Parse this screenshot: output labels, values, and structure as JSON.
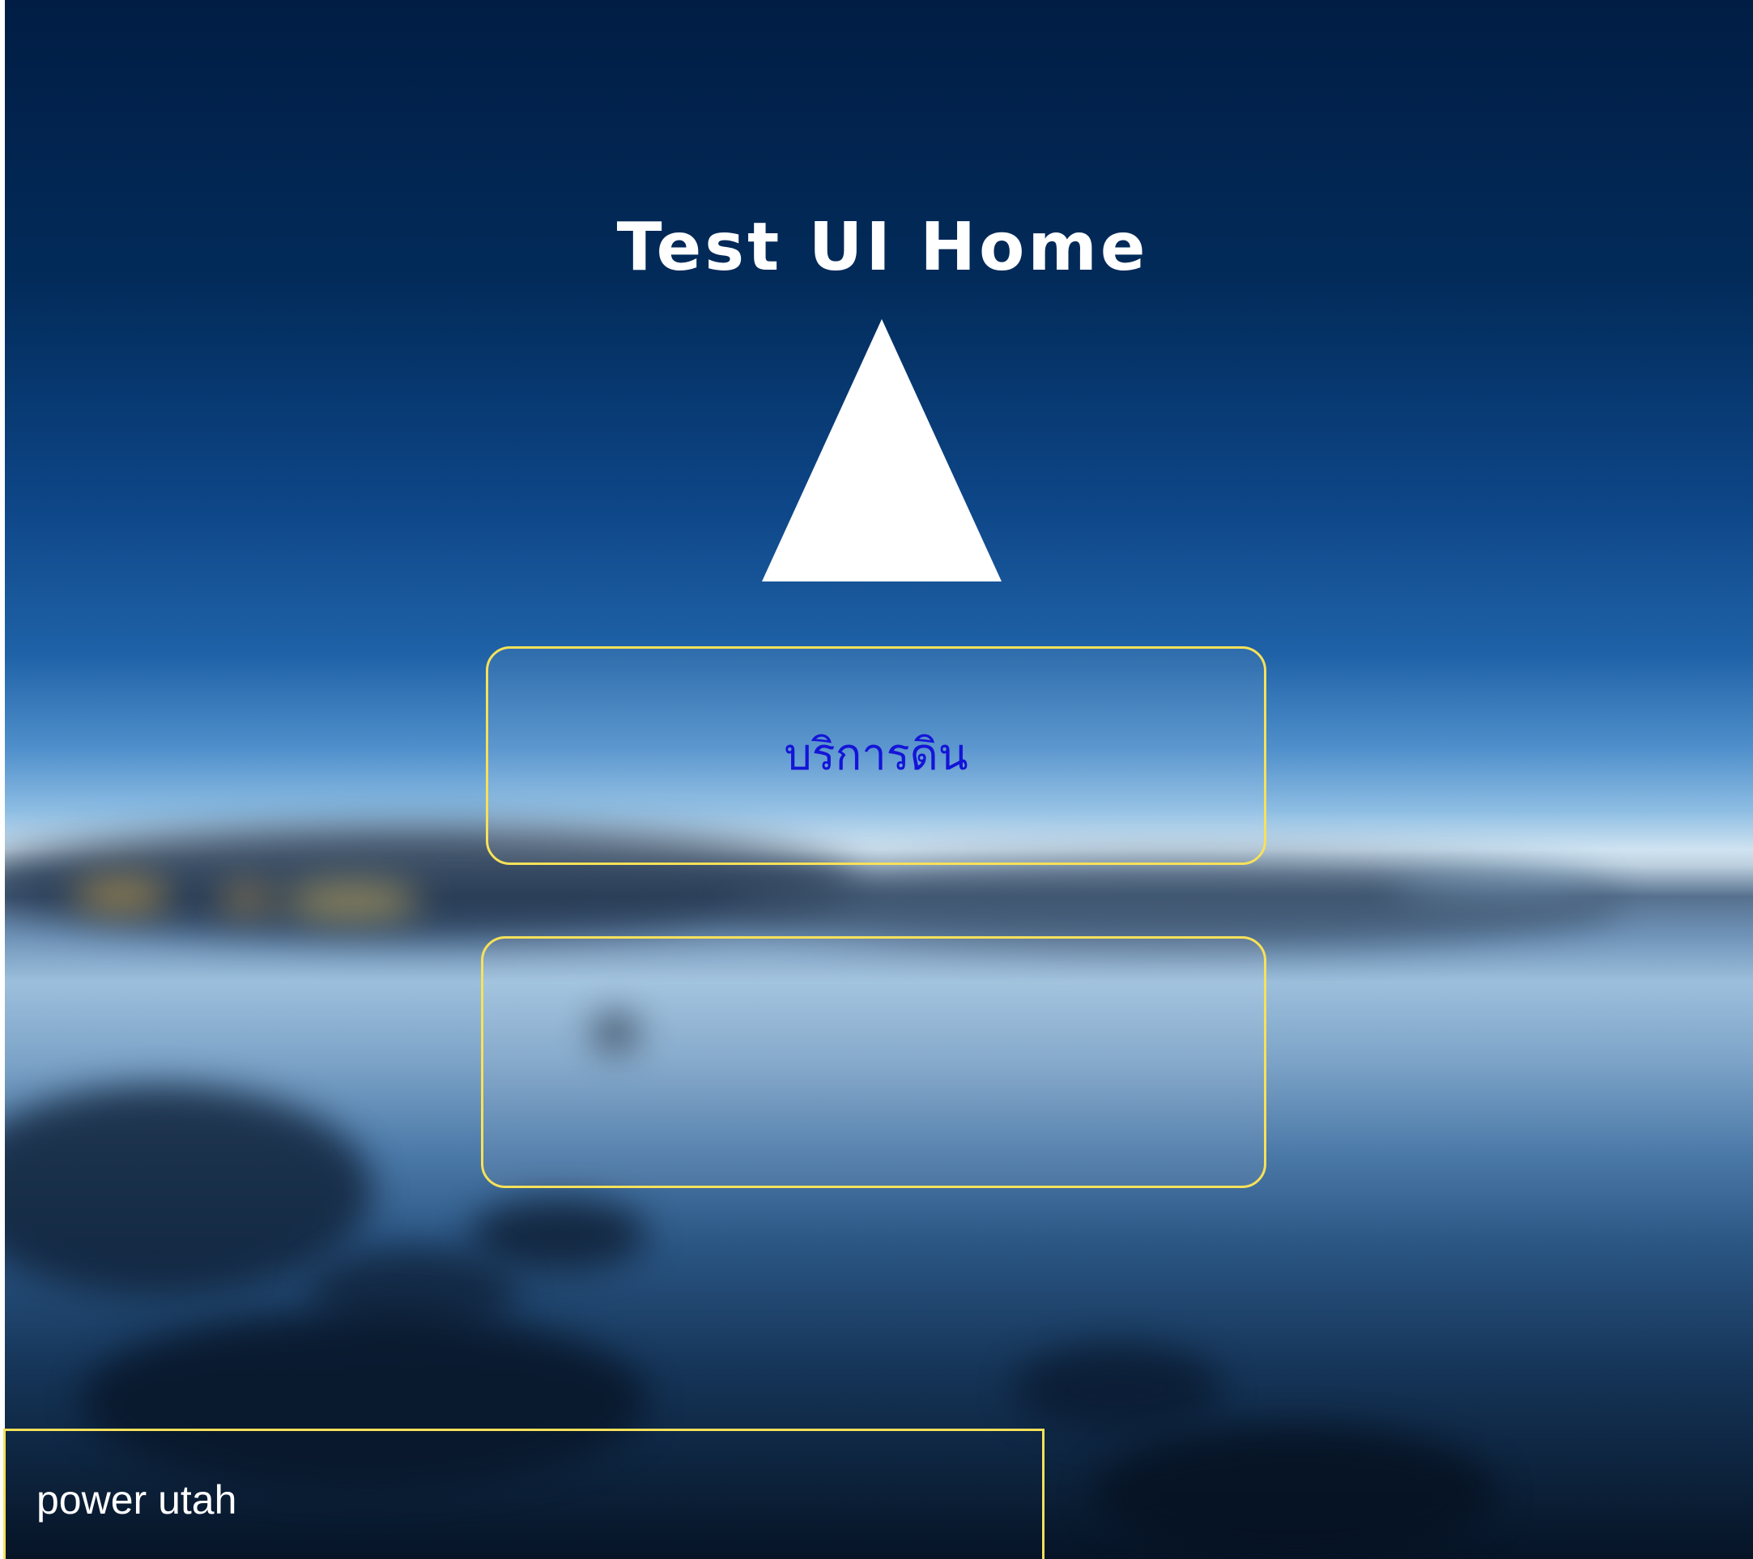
{
  "header": {
    "title": "Test UI Home"
  },
  "logo": {
    "icon": "triangle-logo-icon",
    "color": "#ffffff"
  },
  "menu": {
    "items": [
      {
        "label": "บริการดิน"
      },
      {
        "label": ""
      }
    ]
  },
  "footer": {
    "status_text": "power utah"
  },
  "colors": {
    "accent_border": "#f7e15a",
    "button_text": "#1414d8",
    "title_text": "#ffffff"
  }
}
